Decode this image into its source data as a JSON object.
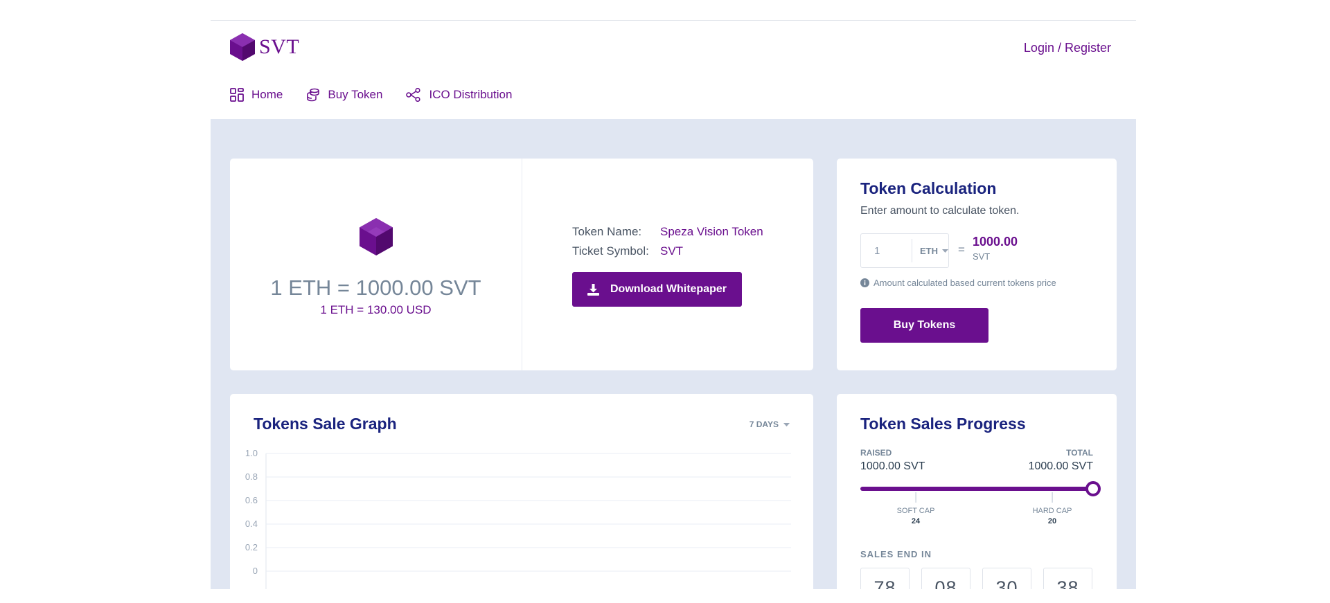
{
  "header": {
    "logo_text": "SVT",
    "login_label": "Login / Register"
  },
  "nav": {
    "items": [
      {
        "label": "Home",
        "icon": "grid-icon"
      },
      {
        "label": "Buy Token",
        "icon": "coins-icon"
      },
      {
        "label": "ICO Distribution",
        "icon": "share-nodes-icon"
      }
    ]
  },
  "token": {
    "rate_main": "1 ETH = 1000.00 SVT",
    "rate_usd": "1 ETH = 130.00 USD",
    "name_label": "Token Name:",
    "name_value": "Speza Vision Token",
    "symbol_label": "Ticket Symbol:",
    "symbol_value": "SVT",
    "download_label": "Download Whitepaper"
  },
  "calc": {
    "title": "Token Calculation",
    "description": "Enter amount to calculate token.",
    "amount": "1",
    "currency": "ETH",
    "equals": "=",
    "result": "1000.00",
    "result_unit": "SVT",
    "note": "Amount calculated based current tokens price",
    "buy_label": "Buy Tokens"
  },
  "graph": {
    "title": "Tokens Sale Graph",
    "range_label": "7 DAYS"
  },
  "chart_data": {
    "type": "line",
    "title": "Tokens Sale Graph",
    "x": [],
    "series": [],
    "yticks": [
      "1.0",
      "0.8",
      "0.6",
      "0.4",
      "0.2",
      "0"
    ],
    "ylim": [
      0,
      1.0
    ],
    "grid": true
  },
  "progress": {
    "title": "Token Sales Progress",
    "raised_label": "RAISED",
    "raised_value": "1000.00 SVT",
    "total_label": "TOTAL",
    "total_value": "1000.00 SVT",
    "fraction": 1.0,
    "soft_cap_label": "SOFT CAP",
    "soft_cap_value": "24",
    "hard_cap_label": "HARD CAP",
    "hard_cap_value": "20",
    "sales_end_label": "SALES END IN",
    "countdown": [
      "78",
      "08",
      "30",
      "38"
    ]
  },
  "colors": {
    "brand": "#6a0f8e",
    "heading": "#1a237e",
    "page_bg": "#e0e6f2"
  }
}
